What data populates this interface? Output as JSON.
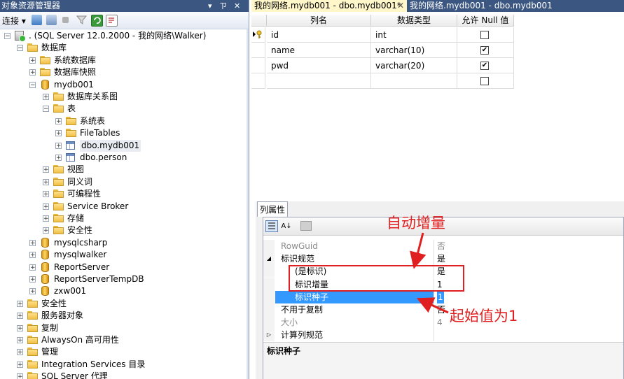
{
  "object_explorer": {
    "title": "对象资源管理器",
    "pin_icon": "pin-icon",
    "close_icon": "close-icon",
    "connect_label": "连接",
    "tree": [
      {
        "label": ". (SQL Server 12.0.2000 - 我的网络\\Walker)",
        "icon": "server-icon",
        "level": 0,
        "state": "-"
      },
      {
        "label": "数据库",
        "icon": "folder-icon",
        "level": 1,
        "state": "-"
      },
      {
        "label": "系统数据库",
        "icon": "folder-icon",
        "level": 2,
        "state": "+"
      },
      {
        "label": "数据库快照",
        "icon": "folder-icon",
        "level": 2,
        "state": "+"
      },
      {
        "label": "mydb001",
        "icon": "database-icon",
        "level": 2,
        "state": "-"
      },
      {
        "label": "数据库关系图",
        "icon": "folder-icon",
        "level": 3,
        "state": "+"
      },
      {
        "label": "表",
        "icon": "folder-icon",
        "level": 3,
        "state": "-"
      },
      {
        "label": "系统表",
        "icon": "folder-icon",
        "level": 4,
        "state": "+"
      },
      {
        "label": "FileTables",
        "icon": "folder-icon",
        "level": 4,
        "state": "+"
      },
      {
        "label": "dbo.mydb001",
        "icon": "table-icon",
        "level": 4,
        "state": "+",
        "selected": true
      },
      {
        "label": "dbo.person",
        "icon": "table-icon",
        "level": 4,
        "state": "+"
      },
      {
        "label": "视图",
        "icon": "folder-icon",
        "level": 3,
        "state": "+"
      },
      {
        "label": "同义词",
        "icon": "folder-icon",
        "level": 3,
        "state": "+"
      },
      {
        "label": "可编程性",
        "icon": "folder-icon",
        "level": 3,
        "state": "+"
      },
      {
        "label": "Service Broker",
        "icon": "folder-icon",
        "level": 3,
        "state": "+"
      },
      {
        "label": "存储",
        "icon": "folder-icon",
        "level": 3,
        "state": "+"
      },
      {
        "label": "安全性",
        "icon": "folder-icon",
        "level": 3,
        "state": "+"
      },
      {
        "label": "mysqlcsharp",
        "icon": "database-icon",
        "level": 2,
        "state": "+"
      },
      {
        "label": "mysqlwalker",
        "icon": "database-icon",
        "level": 2,
        "state": "+"
      },
      {
        "label": "ReportServer",
        "icon": "database-icon",
        "level": 2,
        "state": "+"
      },
      {
        "label": "ReportServerTempDB",
        "icon": "database-icon",
        "level": 2,
        "state": "+"
      },
      {
        "label": "zxw001",
        "icon": "database-icon",
        "level": 2,
        "state": "+"
      },
      {
        "label": "安全性",
        "icon": "folder-icon",
        "level": 1,
        "state": "+"
      },
      {
        "label": "服务器对象",
        "icon": "folder-icon",
        "level": 1,
        "state": "+"
      },
      {
        "label": "复制",
        "icon": "folder-icon",
        "level": 1,
        "state": "+"
      },
      {
        "label": "AlwaysOn 高可用性",
        "icon": "folder-icon",
        "level": 1,
        "state": "+"
      },
      {
        "label": "管理",
        "icon": "folder-icon",
        "level": 1,
        "state": "+"
      },
      {
        "label": "Integration Services 目录",
        "icon": "folder-icon",
        "level": 1,
        "state": "+"
      },
      {
        "label": "SQL Server 代理",
        "icon": "folder-icon",
        "level": 1,
        "state": "+"
      }
    ]
  },
  "tabs": [
    {
      "label": "我的网络.mydb001 - dbo.mydb001*",
      "active": true
    },
    {
      "label": "我的网络.mydb001 - dbo.mydb001",
      "active": false
    }
  ],
  "designer": {
    "headers": [
      "列名",
      "数据类型",
      "允许 Null 值"
    ],
    "rows": [
      {
        "name": "id",
        "type": "int",
        "nullable": false,
        "primary_key": true
      },
      {
        "name": "name",
        "type": "varchar(10)",
        "nullable": true
      },
      {
        "name": "pwd",
        "type": "varchar(20)",
        "nullable": true
      },
      {
        "name": "",
        "type": "",
        "nullable": false
      }
    ]
  },
  "column_properties": {
    "tab_label": "列属性",
    "rows": [
      {
        "name": "RowGuid",
        "value": "否",
        "gray": true
      },
      {
        "name": "标识规范",
        "value": "是",
        "expander": "◢"
      },
      {
        "name": "(是标识)",
        "value": "是",
        "indent": true
      },
      {
        "name": "标识增量",
        "value": "1",
        "indent": true
      },
      {
        "name": "标识种子",
        "value": "1",
        "indent": true,
        "selected": true
      },
      {
        "name": "不用于复制",
        "value": "否"
      },
      {
        "name": "大小",
        "value": "4",
        "gray": true
      },
      {
        "name": "计算列规范",
        "value": "",
        "expander": "▷"
      }
    ],
    "description": "标识种子"
  },
  "annotations": {
    "increment": "自动增量",
    "seed": "起始值为1"
  },
  "colors": {
    "title_bar": "#3b5781",
    "selection": "#3399ff",
    "annotation": "#e02020"
  }
}
